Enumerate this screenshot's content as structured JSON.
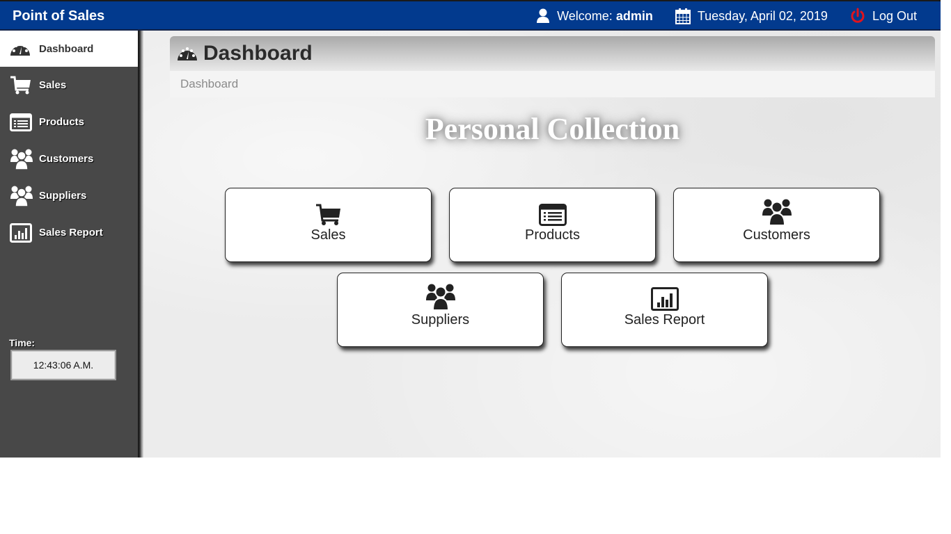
{
  "topbar": {
    "brand": "Point of Sales",
    "welcome_label": "Welcome:",
    "username": "admin",
    "date": "Tuesday, April 02, 2019",
    "logout_label": "Log Out",
    "icons": {
      "user": "user-icon",
      "calendar": "calendar-icon",
      "power": "power-icon"
    },
    "colors": {
      "bar": "#023a8e",
      "power": "#e0141e"
    }
  },
  "sidebar": {
    "items": [
      {
        "label": "Dashboard",
        "icon": "dashboard-gauge-icon",
        "active": true
      },
      {
        "label": "Sales",
        "icon": "shopping-cart-icon",
        "active": false
      },
      {
        "label": "Products",
        "icon": "list-icon",
        "active": false
      },
      {
        "label": "Customers",
        "icon": "users-icon",
        "active": false
      },
      {
        "label": "Suppliers",
        "icon": "users-icon",
        "active": false
      },
      {
        "label": "Sales Report",
        "icon": "bar-chart-icon",
        "active": false
      }
    ],
    "time_label": "Time:",
    "time_value": "12:43:06 A.M."
  },
  "main": {
    "page_title": "Dashboard",
    "breadcrumb": "Dashboard",
    "collection_title": "Personal Collection",
    "tiles": [
      {
        "label": "Sales",
        "icon": "shopping-cart-icon"
      },
      {
        "label": "Products",
        "icon": "list-icon"
      },
      {
        "label": "Customers",
        "icon": "users-icon"
      },
      {
        "label": "Suppliers",
        "icon": "users-icon"
      },
      {
        "label": "Sales Report",
        "icon": "bar-chart-icon"
      }
    ]
  }
}
